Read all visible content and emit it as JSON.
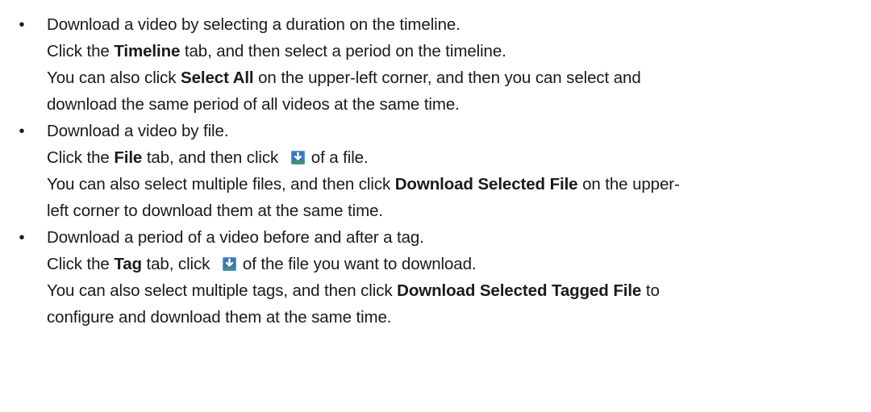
{
  "bullet_glyph": "•",
  "items": [
    {
      "heading": "Download a video by selecting a duration on the timeline.",
      "step": {
        "pre": "Click the ",
        "tab": "Timeline",
        "post": " tab, and then select a period on the timeline."
      },
      "note_line1": {
        "pre": "You can also click ",
        "button": "Select All",
        "post": " on the upper-left corner, and then you can select and"
      },
      "note_line2": "download the same period of all videos at the same time."
    },
    {
      "heading": "Download a video by file.",
      "step": {
        "pre": "Click the ",
        "tab": "File",
        "mid": " tab, and then click ",
        "post": "of a file."
      },
      "note_line1": {
        "pre": "You can also select multiple files, and then click ",
        "button": "Download Selected File",
        "post": " on the upper-"
      },
      "note_line2": "left corner to download them at the same time."
    },
    {
      "heading": "Download a period of a video before and after a tag.",
      "step": {
        "pre": "Click the ",
        "tab": "Tag",
        "mid": " tab, click ",
        "post": "of the file you want to download."
      },
      "note_line1": {
        "pre": "You can also select multiple tags, and then click ",
        "button": "Download Selected Tagged File",
        "post": " to"
      },
      "note_line2": "configure and download them at the same time."
    }
  ],
  "icons": {
    "download": "download-icon"
  },
  "colors": {
    "text": "#1a1a1a",
    "icon_green": "#3e9a43",
    "icon_blue": "#3b6fb6"
  }
}
